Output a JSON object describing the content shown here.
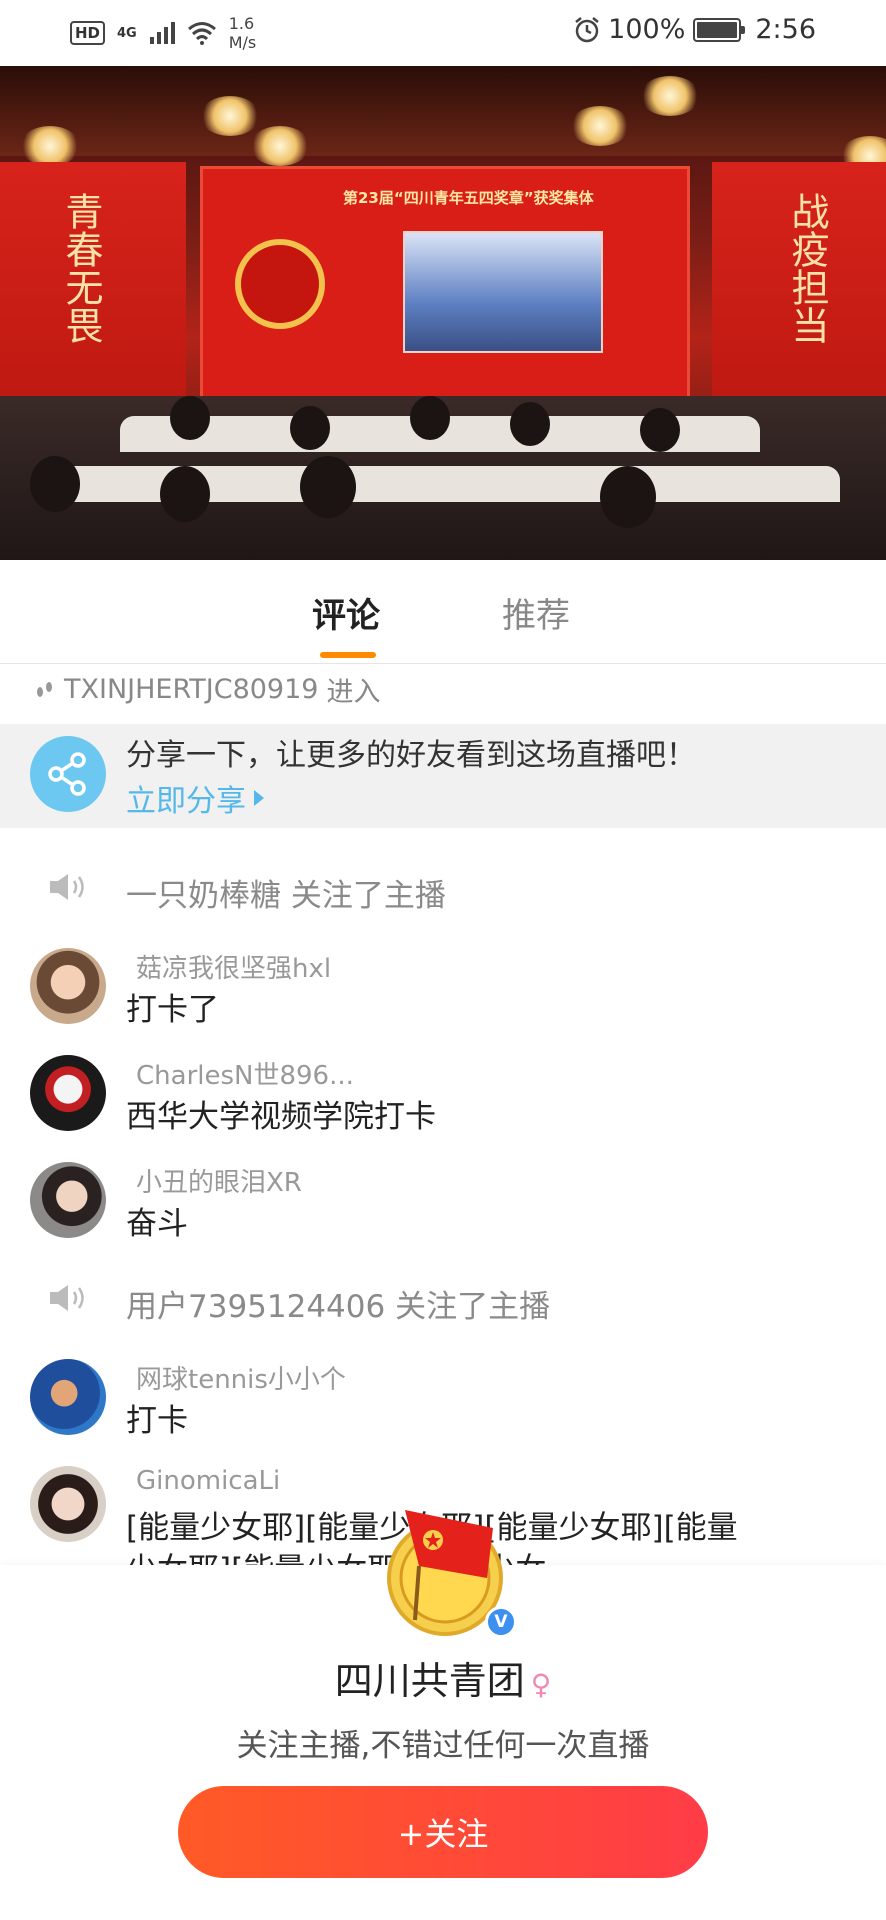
{
  "status_bar": {
    "hd": "HD",
    "network": "4G",
    "speed_value": "1.6",
    "speed_unit": "M/s",
    "battery": "100%",
    "time": "2:56"
  },
  "video": {
    "left_banner": "青春无畏",
    "right_banner": "战疫担当",
    "screen_title": "第23届“四川青年五四奖章”获奖集体"
  },
  "tabs": [
    {
      "label": "评论",
      "active": true
    },
    {
      "label": "推荐",
      "active": false
    }
  ],
  "feed": {
    "entry": {
      "user": "TXINJHERTJC80919",
      "action": "进入"
    },
    "share": {
      "text": "分享一下，让更多的好友看到这场直播吧！",
      "link": "立即分享"
    },
    "system_1": {
      "user": "一只奶棒糖",
      "action": "关注了主播"
    },
    "comments": [
      {
        "name": "菇凉我很坚强hxl",
        "message": "打卡了"
      },
      {
        "name": "CharlesN世896...",
        "message": "西华大学视频学院打卡"
      },
      {
        "name": "小丑的眼泪XR",
        "message": "奋斗"
      }
    ],
    "system_2": {
      "user": "用户7395124406",
      "action": "关注了主播"
    },
    "comments_2": [
      {
        "name": "网球tennis小小个",
        "message": "打卡"
      },
      {
        "name": "GinomicaLi",
        "message": "[能量少女耶][能量少女耶][能量少女耶][能量",
        "message_2": "少女耶][能量少女耶][能量少女"
      }
    ]
  },
  "follow_sheet": {
    "anchor_name": "四川共青团",
    "gender_symbol": "♀",
    "verified_symbol": "V",
    "tip": "关注主播,不错过任何一次直播",
    "button": "+关注"
  }
}
